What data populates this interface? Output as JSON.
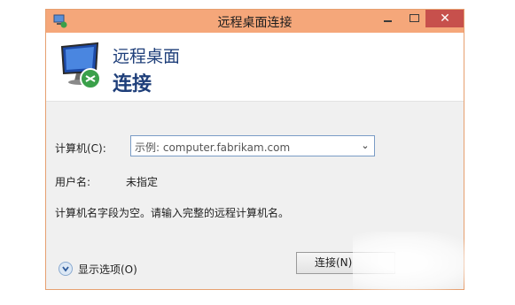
{
  "window": {
    "title": "远程桌面连接",
    "close_glyph": "✕"
  },
  "header": {
    "subtitle": "远程桌面",
    "title": "连接"
  },
  "form": {
    "computer_label": "计算机(C):",
    "computer_placeholder": "示例: computer.fabrikam.com",
    "username_label": "用户名:",
    "username_value": "未指定",
    "message": "计算机名字段为空。请输入完整的远程计算机名。"
  },
  "footer": {
    "show_options_label": "显示选项(O)",
    "connect_label": "连接(N)"
  },
  "icons": [
    "rdp-app-icon",
    "minimize-icon",
    "maximize-icon",
    "close-icon",
    "monitor-icon",
    "chevron-down-icon",
    "expand-options-icon"
  ],
  "colors": {
    "titlebar": "#f5a77a",
    "close_button": "#c7504c",
    "heading": "#1f3f7a"
  }
}
